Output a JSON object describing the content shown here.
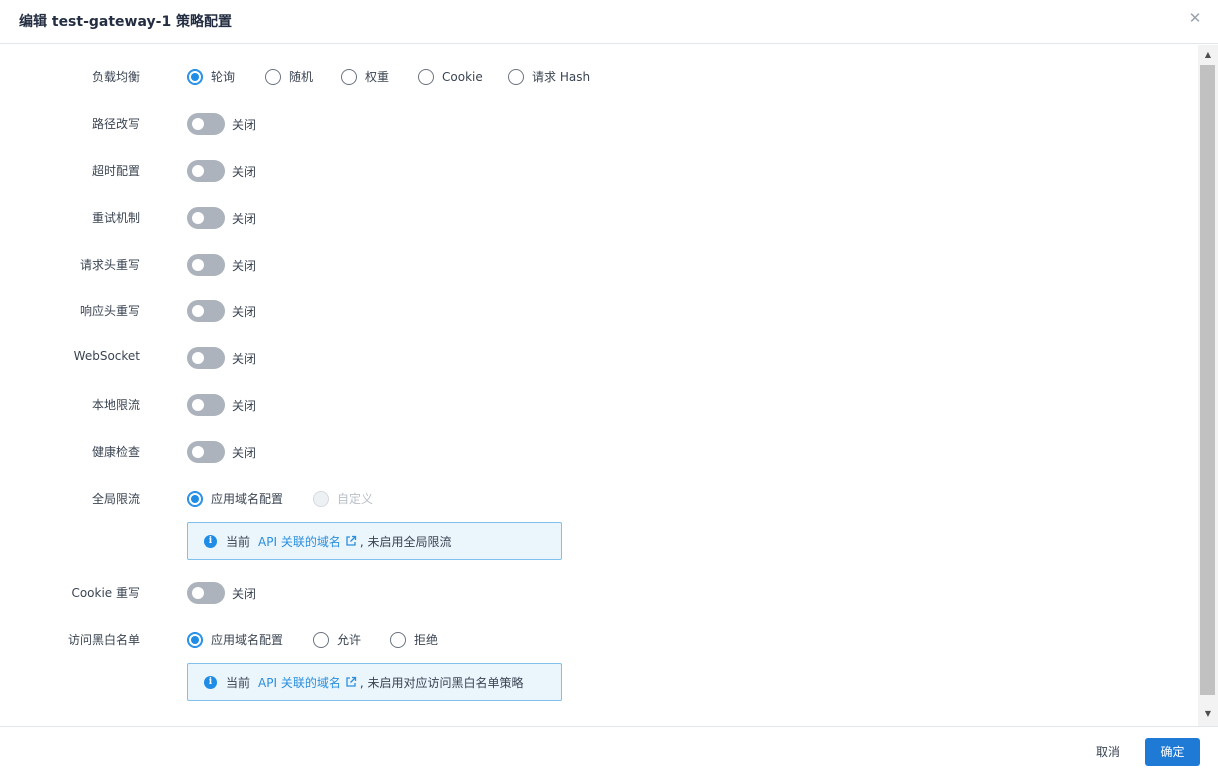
{
  "dialog": {
    "title": "编辑 test-gateway-1 策略配置",
    "close_icon": "close-icon"
  },
  "form": {
    "load_balance": {
      "label": "负载均衡",
      "options": [
        "轮询",
        "随机",
        "权重",
        "Cookie",
        "请求 Hash"
      ],
      "selected": "轮询"
    },
    "path_rewrite": {
      "label": "路径改写",
      "state": "关闭"
    },
    "timeout": {
      "label": "超时配置",
      "state": "关闭"
    },
    "retry": {
      "label": "重试机制",
      "state": "关闭"
    },
    "req_header_rewrite": {
      "label": "请求头重写",
      "state": "关闭"
    },
    "resp_header_rewrite": {
      "label": "响应头重写",
      "state": "关闭"
    },
    "websocket": {
      "label": "WebSocket",
      "state": "关闭"
    },
    "local_rate_limit": {
      "label": "本地限流",
      "state": "关闭"
    },
    "health_check": {
      "label": "健康检查",
      "state": "关闭"
    },
    "global_rate_limit": {
      "label": "全局限流",
      "options": [
        "应用域名配置",
        "自定义"
      ],
      "selected": "应用域名配置",
      "disabled": "自定义",
      "info": {
        "prefix": "当前",
        "link": "API 关联的域名",
        "suffix": ", 未启用全局限流"
      }
    },
    "cookie_rewrite": {
      "label": "Cookie 重写",
      "state": "关闭"
    },
    "access_list": {
      "label": "访问黑白名单",
      "options": [
        "应用域名配置",
        "允许",
        "拒绝"
      ],
      "selected": "应用域名配置",
      "info": {
        "prefix": "当前",
        "link": "API 关联的域名",
        "suffix": ", 未启用对应访问黑白名单策略"
      }
    }
  },
  "footer": {
    "cancel_label": "取消",
    "ok_label": "确定"
  },
  "colors": {
    "accent": "#1f8ce6",
    "primary_button": "#1f7ad6",
    "switch_off": "#adb3bc",
    "info_bg": "#eaf5fc",
    "info_border": "#7fc0ec"
  }
}
